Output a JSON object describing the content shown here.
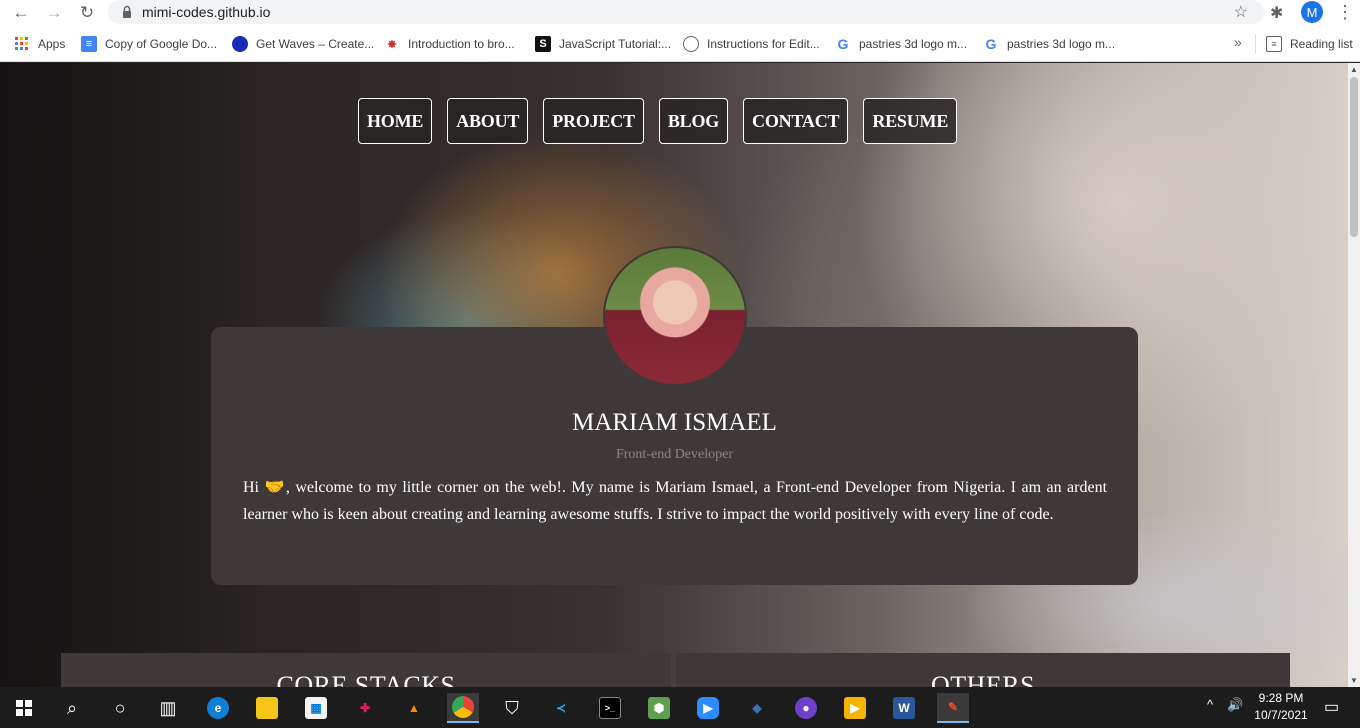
{
  "browser": {
    "url": "mimi-codes.github.io",
    "profile_initial": "M",
    "bookmarks": [
      {
        "label": "Apps",
        "icon": "apps-grid-icon"
      },
      {
        "label": "Copy of Google Do...",
        "icon": "google-docs-icon"
      },
      {
        "label": "Get Waves – Create...",
        "icon": "waves-icon"
      },
      {
        "label": "Introduction to bro...",
        "icon": "figure-icon"
      },
      {
        "label": "JavaScript Tutorial:...",
        "icon": "s-logo-icon"
      },
      {
        "label": "Instructions for Edit...",
        "icon": "globe-icon"
      },
      {
        "label": "pastries 3d logo m...",
        "icon": "google-icon"
      },
      {
        "label": "pastries 3d logo m...",
        "icon": "google-icon"
      }
    ],
    "more_label": "»",
    "reading_list": "Reading list"
  },
  "nav": {
    "items": [
      "HOME",
      "ABOUT",
      "PROJECT",
      "BLOG",
      "CONTACT",
      "RESUME"
    ]
  },
  "profile": {
    "name": "MARIAM ISMAEL",
    "role": "Front-end Developer",
    "bio_pre": "Hi ",
    "bio_emoji": "🤝",
    "bio_post": ", welcome to my little corner on the web!. My name is Mariam Ismael, a Front-end Developer from Nigeria. I am an ardent learner who is keen about creating and learning awesome stuffs. I strive to impact the world positively with every line of code."
  },
  "sections": {
    "left": "CORE STACKS",
    "right": "OTHERS"
  },
  "taskbar": {
    "time": "9:28 PM",
    "date": "10/7/2021"
  }
}
